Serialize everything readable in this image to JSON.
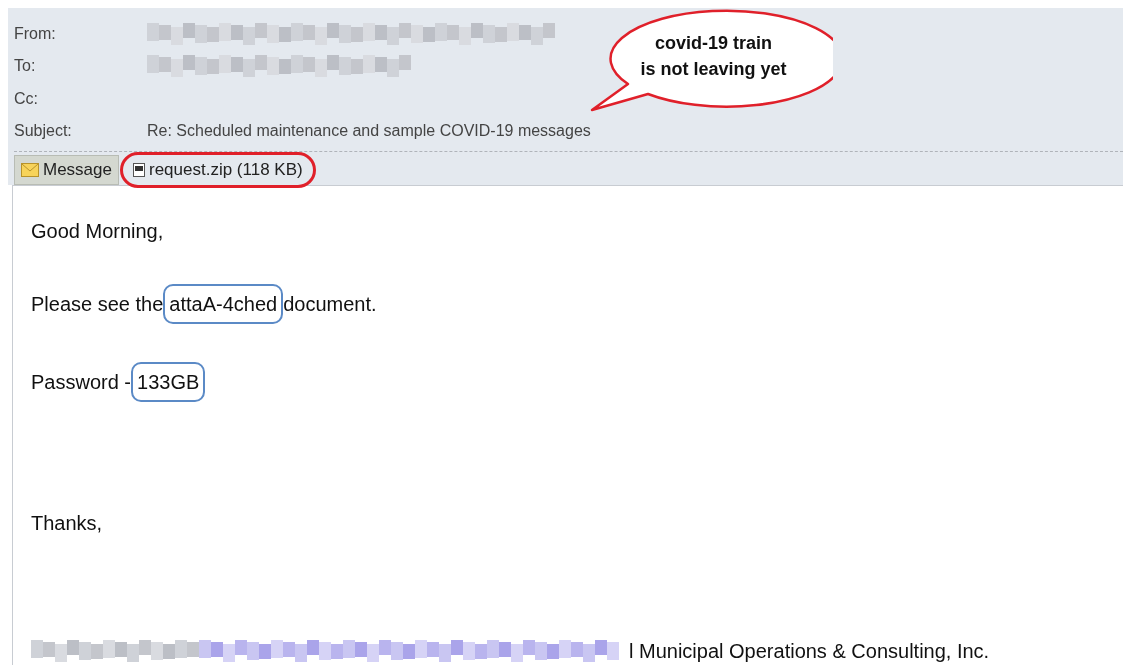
{
  "header": {
    "fields": [
      {
        "label": "From:",
        "kind": "redacted"
      },
      {
        "label": "To:",
        "kind": "redacted"
      },
      {
        "label": "Cc:",
        "kind": "empty"
      },
      {
        "label": "Subject:",
        "kind": "text",
        "value": "Re: Scheduled maintenance and sample COVID-19 messages"
      }
    ]
  },
  "tabs": [
    {
      "label": "Message",
      "kind": "message",
      "selected": true
    },
    {
      "label": "request.zip (118 KB)",
      "kind": "attachment",
      "selected": false
    }
  ],
  "callout": {
    "lines": [
      "covid-19 train",
      "is not leaving yet"
    ]
  },
  "body": {
    "paragraphs": [
      {
        "kind": "plain",
        "text": "Good Morning,"
      },
      {
        "kind": "marked",
        "before": "Please see the",
        "marked": "attaA-4ched",
        "after": "document."
      },
      {
        "kind": "marked",
        "before": "Password -",
        "marked": "133GB"
      },
      {
        "kind": "closing",
        "text": "Thanks,"
      },
      {
        "kind": "signature",
        "text": "l Municipal Operations & Consulting, Inc."
      }
    ]
  }
}
